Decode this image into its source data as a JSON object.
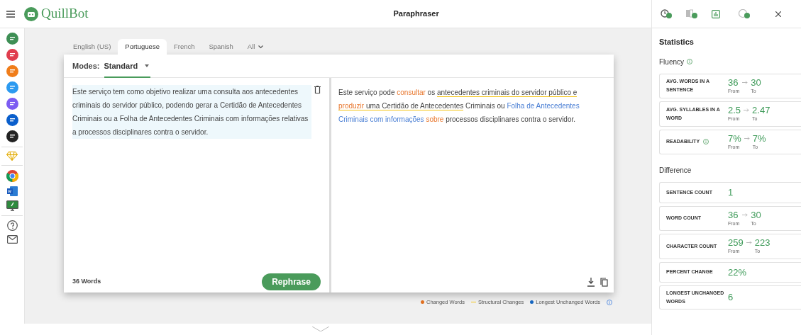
{
  "header": {
    "logo": "QuillBot",
    "title": "Paraphraser"
  },
  "tabs": [
    {
      "label": "English (US)",
      "selected": false
    },
    {
      "label": "Portuguese",
      "selected": true
    },
    {
      "label": "French",
      "selected": false
    },
    {
      "label": "Spanish",
      "selected": false
    },
    {
      "label": "All",
      "selected": false,
      "dropdown": true
    }
  ],
  "modes": {
    "label": "Modes:",
    "value": "Standard"
  },
  "input": {
    "text": "Este serviço tem como objetivo realizar uma consulta aos antecedentes criminais do servidor público, podendo gerar a Certidão de Antecedentes Criminais ou a Folha de Antecedentes Criminais com informações relativas a processos disciplinares contra o servidor.",
    "word_count": "36 Words"
  },
  "rephrase_button": "Rephrase",
  "output": {
    "segments": [
      {
        "text": "Este serviço pode ",
        "kind": "plain"
      },
      {
        "text": "consultar",
        "kind": "changed"
      },
      {
        "text": " os ",
        "kind": "plain"
      },
      {
        "text": "antecedentes criminais do servidor público e ",
        "kind": "structural"
      },
      {
        "text": "produzir",
        "kind": "changed_structural"
      },
      {
        "text": " uma Certidão de Antecedentes",
        "kind": "structural"
      },
      {
        "text": " Criminais ou ",
        "kind": "plain"
      },
      {
        "text": "Folha de Antecedentes Criminais com informações ",
        "kind": "longest"
      },
      {
        "text": "sobre",
        "kind": "changed"
      },
      {
        "text": " processos disciplinares contra o servidor.",
        "kind": "plain"
      }
    ]
  },
  "legend": [
    {
      "label": "Changed Words",
      "kind": "dot",
      "color": "#e07020"
    },
    {
      "label": "Structural Changes",
      "kind": "line",
      "color": "#f5c518"
    },
    {
      "label": "Longest Unchanged Words",
      "kind": "dot",
      "color": "#1565c0"
    }
  ],
  "statistics": {
    "title": "Statistics",
    "sections": [
      {
        "title": "Fluency",
        "info": true,
        "cards": [
          {
            "label": "AVG. WORDS IN A SENTENCE",
            "info": false,
            "from": "36",
            "to": "30",
            "from_label": "From",
            "to_label": "To"
          },
          {
            "label": "AVG. SYLLABLES IN A WORD",
            "info": false,
            "from": "2.5",
            "to": "2.47",
            "from_label": "From",
            "to_label": "To"
          },
          {
            "label": "READABILITY",
            "info": true,
            "from": "7%",
            "to": "7%",
            "from_label": "From",
            "to_label": "To"
          }
        ]
      },
      {
        "title": "Difference",
        "info": false,
        "cards": [
          {
            "label": "SENTENCE COUNT",
            "info": false,
            "value": "1"
          },
          {
            "label": "WORD COUNT",
            "info": false,
            "from": "36",
            "to": "30",
            "from_label": "From",
            "to_label": "To"
          },
          {
            "label": "CHARACTER COUNT",
            "info": false,
            "from": "259",
            "to": "223",
            "from_label": "From",
            "to_label": "To"
          },
          {
            "label": "PERCENT CHANGE",
            "info": false,
            "value": "22%"
          },
          {
            "label": "LONGEST UNCHANGED WORDS",
            "info": false,
            "value": "6"
          }
        ]
      }
    ]
  }
}
